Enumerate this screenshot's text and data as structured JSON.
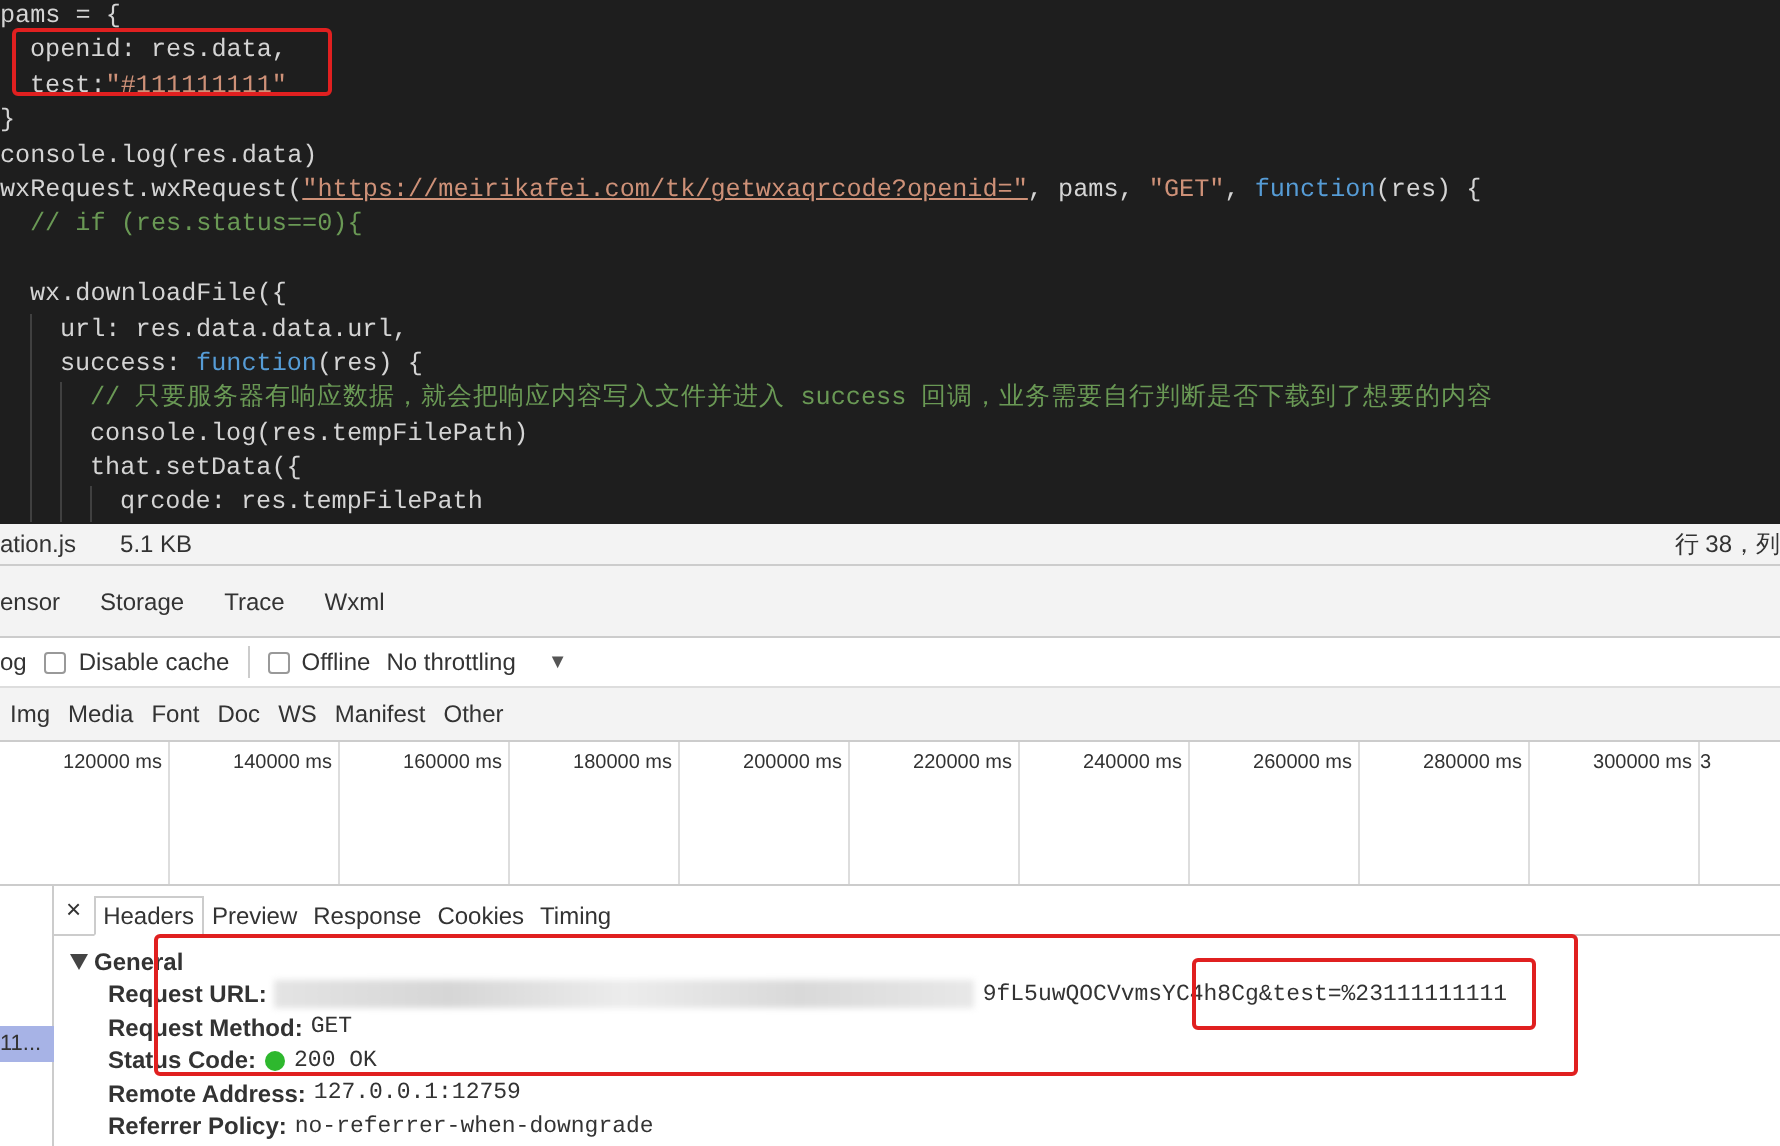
{
  "editor": {
    "lines": [
      {
        "kind": "code",
        "tokens": [
          {
            "text": "pams = {",
            "kind": "plain"
          }
        ],
        "children": [
          {
            "kind": "code",
            "tokens": [
              {
                "text": "openid: res.data,",
                "kind": "plain"
              }
            ]
          },
          {
            "kind": "code",
            "tokens": [
              {
                "text": "test:",
                "kind": "plain"
              },
              {
                "text": "\"#111111111\"",
                "kind": "string"
              }
            ]
          }
        ]
      },
      {
        "kind": "code",
        "tokens": [
          {
            "text": "}",
            "kind": "plain"
          }
        ]
      },
      {
        "kind": "code",
        "tokens": [
          {
            "text": "console.log(res.data)",
            "kind": "plain"
          }
        ]
      },
      {
        "kind": "code",
        "tokens": [
          {
            "text": "wxRequest.wxRequest(",
            "kind": "plain"
          },
          {
            "text": "\"https://meirikafei.com/tk/getwxaqrcode?openid=\"",
            "kind": "link"
          },
          {
            "text": ", pams, ",
            "kind": "plain"
          },
          {
            "text": "\"GET\"",
            "kind": "string"
          },
          {
            "text": ", ",
            "kind": "plain"
          },
          {
            "text": "function",
            "kind": "keyword"
          },
          {
            "text": "(res) {",
            "kind": "plain"
          }
        ],
        "children": [
          {
            "kind": "code",
            "tokens": [
              {
                "text": "// if (res.status==0){",
                "kind": "comment"
              }
            ]
          },
          {
            "kind": "blank"
          },
          {
            "kind": "code",
            "tokens": [
              {
                "text": "wx.downloadFile({",
                "kind": "plain"
              }
            ],
            "children": [
              {
                "kind": "code",
                "tokens": [
                  {
                    "text": "url: res.data.data.url,",
                    "kind": "plain"
                  }
                ]
              },
              {
                "kind": "code",
                "tokens": [
                  {
                    "text": "success: ",
                    "kind": "plain"
                  },
                  {
                    "text": "function",
                    "kind": "keyword"
                  },
                  {
                    "text": "(res) {",
                    "kind": "plain"
                  }
                ],
                "children": [
                  {
                    "kind": "code",
                    "tokens": [
                      {
                        "text": "// 只要服务器有响应数据，就会把响应内容写入文件并进入 success 回调，业务需要自行判断是否下载到了想要的内容",
                        "kind": "comment"
                      }
                    ]
                  },
                  {
                    "kind": "code",
                    "tokens": [
                      {
                        "text": "console.log(res.tempFilePath)",
                        "kind": "plain"
                      }
                    ]
                  },
                  {
                    "kind": "code",
                    "tokens": [
                      {
                        "text": "that.setData({",
                        "kind": "plain"
                      }
                    ],
                    "children": [
                      {
                        "kind": "code",
                        "tokens": [
                          {
                            "text": "qrcode: res.tempFilePath",
                            "kind": "plain"
                          }
                        ]
                      }
                    ]
                  }
                ]
              }
            ]
          }
        ]
      }
    ]
  },
  "status_bar": {
    "file": "ation.js",
    "size": "5.1 KB",
    "position": "行 38，列"
  },
  "panel_tabs": [
    {
      "label": "ensor",
      "selected": false
    },
    {
      "label": "Storage",
      "selected": false
    },
    {
      "label": "Trace",
      "selected": false
    },
    {
      "label": "Wxml",
      "selected": false
    }
  ],
  "toolbar": {
    "cut_label": "og",
    "disable_cache": {
      "label": "Disable cache",
      "checked": false
    },
    "offline": {
      "label": "Offline",
      "checked": false
    },
    "throttling": "No throttling",
    "dropdown_glyph": "▼"
  },
  "filters": [
    "Img",
    "Media",
    "Font",
    "Doc",
    "WS",
    "Manifest",
    "Other"
  ],
  "timeline": {
    "ticks": [
      "120000 ms",
      "140000 ms",
      "160000 ms",
      "180000 ms",
      "200000 ms",
      "220000 ms",
      "240000 ms",
      "260000 ms",
      "280000 ms",
      "300000 ms",
      "3"
    ]
  },
  "requests": [
    {
      "label": "11...",
      "selected": true
    }
  ],
  "details": {
    "close": "×",
    "tabs": [
      {
        "label": "Headers",
        "selected": true
      },
      {
        "label": "Preview",
        "selected": false
      },
      {
        "label": "Response",
        "selected": false
      },
      {
        "label": "Cookies",
        "selected": false
      },
      {
        "label": "Timing",
        "selected": false
      }
    ],
    "section": {
      "title": "General",
      "expanded": true,
      "rows": [
        {
          "key": "Request URL:",
          "value": "9fL5uwQOCVvmsYC4h8Cg&test=%23111111111",
          "kind": "redacted"
        },
        {
          "key": "Request Method:",
          "value": "GET",
          "kind": "plain"
        },
        {
          "key": "Status Code:",
          "value": "200 OK",
          "kind": "status"
        },
        {
          "key": "Remote Address:",
          "value": "127.0.0.1:12759",
          "kind": "plain"
        },
        {
          "key": "Referrer Policy:",
          "value": "no-referrer-when-downgrade",
          "kind": "plain"
        }
      ]
    }
  }
}
